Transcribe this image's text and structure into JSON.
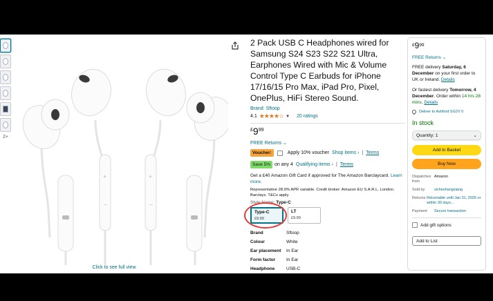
{
  "gallery": {
    "thumbs": [
      "thumb-1",
      "thumb-2",
      "thumb-3",
      "thumb-4",
      "thumb-5",
      "thumb-6"
    ],
    "more_label": "2+",
    "full_view_link": "Click to see full view"
  },
  "product": {
    "title": "2 Pack USB C Headphones wired for Samsung S24 S23 S22 S21 Ultra, Earphones Wired with Mic & Volume Control Type C Earbuds for iPhone 17/16/15 Pro Max, iPad Pro, Pixel, OnePlus, HiFi Stereo Sound.",
    "brand_link": "Brand: Sftoop",
    "rating": "4.1",
    "stars": "★★★★☆",
    "ratings_count": "20 ratings",
    "price": {
      "currency": "£",
      "whole": "9",
      "fraction": "99"
    },
    "returns": "FREE Returns",
    "voucher": {
      "badge": "Voucher:",
      "text": "Apply 10% voucher",
      "shop_link": "Shop items ›",
      "terms": "Terms"
    },
    "save": {
      "badge": "Save 5%",
      "text": "on any 4",
      "qualifying_link": "Qualifying items ›",
      "terms": "Terms"
    },
    "gift_card": "Get a £40 Amazon Gift Card if approved for The Amazon Barclaycard.",
    "learn_more": "Learn more.",
    "apr": "Representative 28.9% APR variable. Credit broker: Amazon EU S.A.R.L. London. Barclays. T&Cs apply.",
    "style_label": "Style Name:",
    "style_value": "Type-C",
    "styles": [
      {
        "label": "Type-C",
        "price": "£9.99"
      },
      {
        "label": "LT",
        "price": "£9.99"
      }
    ],
    "specs": [
      {
        "key": "Brand",
        "value": "Sftoop"
      },
      {
        "key": "Colour",
        "value": "White"
      },
      {
        "key": "Ear placement",
        "value": "In Ear"
      },
      {
        "key": "Form factor",
        "value": "In Ear"
      },
      {
        "key": "Headphone",
        "value": "USB-C"
      }
    ]
  },
  "buybox": {
    "price": {
      "currency": "£",
      "whole": "9",
      "fraction": "99"
    },
    "returns": "FREE Returns",
    "delivery_1_pre": "FREE delivery",
    "delivery_1_date": "Saturday, 6 December",
    "delivery_1_post": "on your first order to UK or Ireland.",
    "delivery_1_link": "Details",
    "delivery_2_pre": "Or fastest delivery",
    "delivery_2_date": "Tomorrow, 4 December",
    "delivery_2_post": ". Order within",
    "delivery_2_time": "14 hrs 28 mins.",
    "delivery_2_link": "Details",
    "deliver_to": "Deliver to Ashford SG2V 0",
    "stock": "In stock",
    "quantity": "Quantity: 1",
    "add_to_basket": "Add to Basket",
    "buy_now": "Buy Now",
    "info": [
      {
        "key": "Dispatches from",
        "value": "Amazon",
        "link": false
      },
      {
        "key": "Sold by",
        "value": "sicheshangxiang",
        "link": true
      },
      {
        "key": "Returns",
        "value": "Returnable until Jan 31, 2026 or within 30 days...",
        "link": true
      },
      {
        "key": "Payment",
        "value": "Secure transaction",
        "link": true
      }
    ],
    "gift_options": "Add gift options",
    "add_to_list": "Add to List"
  },
  "colors": {
    "link": "#007185",
    "add_to_basket": "#ffd814",
    "buy_now": "#ffa41c",
    "in_stock": "#007600",
    "voucher_badge": "#f7a43b",
    "save_badge": "#7fda69",
    "annotation_circle": "#e33a3a"
  }
}
